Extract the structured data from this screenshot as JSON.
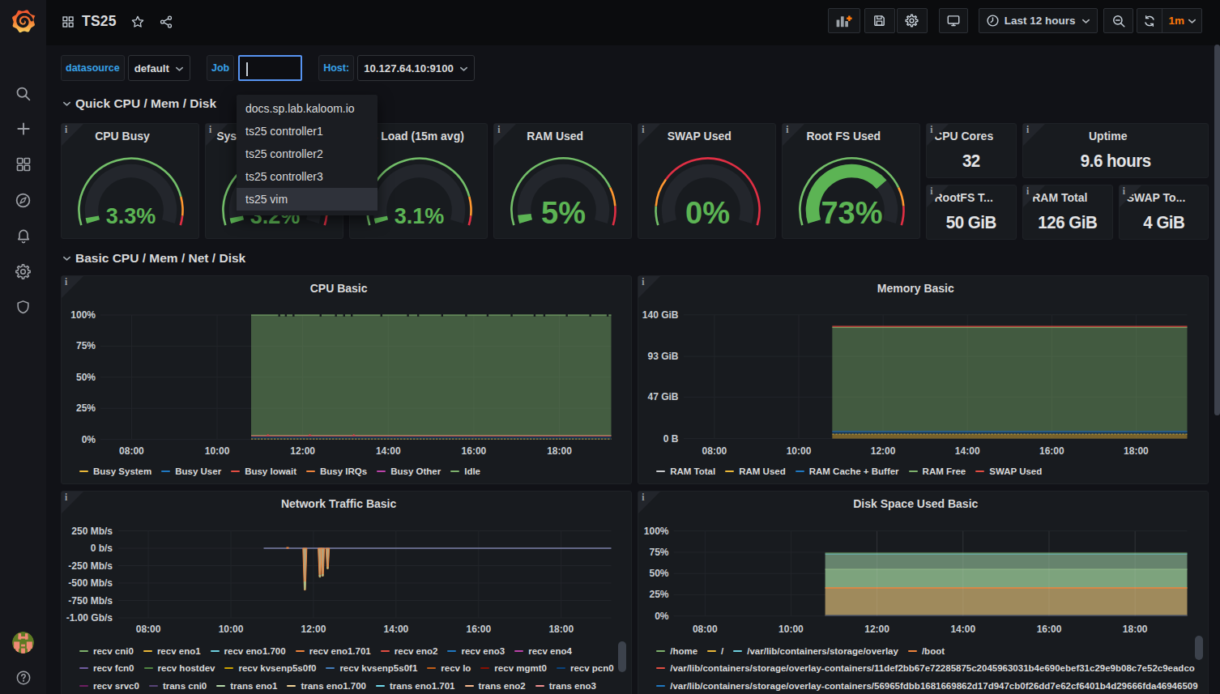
{
  "nav": {
    "title": "TS25",
    "time_range": "Last 12 hours",
    "refresh_interval": "1m",
    "actions": [
      "add-panel",
      "save-dashboard",
      "dashboard-settings",
      "cycle-view-mode",
      "time-picker",
      "zoom-out-time-range",
      "refresh-dashboard",
      "refresh-interval-picker"
    ]
  },
  "sidebar": {
    "items": [
      "search",
      "create",
      "dashboards",
      "explore",
      "alerting",
      "configuration",
      "server-admin"
    ],
    "bottom": [
      "user-avatar",
      "help"
    ]
  },
  "variables": [
    {
      "label": "datasource",
      "value": "default"
    },
    {
      "label": "Job",
      "value": ""
    },
    {
      "label": "Host:",
      "value": "10.127.64.10:9100"
    }
  ],
  "job_dropdown": {
    "options": [
      "docs.sp.lab.kaloom.io",
      "ts25 controller1",
      "ts25 controller2",
      "ts25 controller3",
      "ts25 vim"
    ],
    "highlighted": "ts25 vim"
  },
  "rows": [
    {
      "title": "Quick CPU / Mem / Disk"
    },
    {
      "title": "Basic CPU / Mem / Net / Disk"
    }
  ],
  "colors": {
    "green": "#5cb454",
    "orange": "#ff9830",
    "red": "#e02f44",
    "track": "#23262c",
    "panel": "#181b1f",
    "grid": "#22252a",
    "accent_orange": "#ff780a",
    "focus_blue": "#5794f2"
  },
  "gauges": [
    {
      "title": "CPU Busy",
      "value": "3.3%",
      "fraction": 0.033,
      "col": 0,
      "big": false,
      "thresholds": [
        {
          "to": 0.85,
          "color": "#73bf69"
        },
        {
          "to": 0.95,
          "color": "#ff9830"
        },
        {
          "to": 1,
          "color": "#e02f44"
        }
      ]
    },
    {
      "title": "Sys Load (5m avg)",
      "value": "3.2%",
      "fraction": 0.032,
      "col": 3,
      "big": false,
      "thresholds": [
        {
          "to": 0.85,
          "color": "#73bf69"
        },
        {
          "to": 0.95,
          "color": "#ff9830"
        },
        {
          "to": 1,
          "color": "#e02f44"
        }
      ]
    },
    {
      "title": "Sys Load (15m avg)",
      "value": "3.1%",
      "fraction": 0.031,
      "col": 6,
      "big": false,
      "thresholds": [
        {
          "to": 0.85,
          "color": "#73bf69"
        },
        {
          "to": 0.95,
          "color": "#ff9830"
        },
        {
          "to": 1,
          "color": "#e02f44"
        }
      ]
    },
    {
      "title": "RAM Used",
      "value": "5%",
      "fraction": 0.05,
      "col": 9,
      "big": true,
      "thresholds": [
        {
          "to": 0.8,
          "color": "#73bf69"
        },
        {
          "to": 0.9,
          "color": "#ff9830"
        },
        {
          "to": 1,
          "color": "#e02f44"
        }
      ]
    },
    {
      "title": "SWAP Used",
      "value": "0%",
      "fraction": 0.0,
      "col": 12,
      "big": true,
      "thresholds": [
        {
          "to": 0.1,
          "color": "#73bf69"
        },
        {
          "to": 0.25,
          "color": "#ff9830"
        },
        {
          "to": 1,
          "color": "#e02f44"
        }
      ]
    },
    {
      "title": "Root FS Used",
      "value": "73%",
      "fraction": 0.73,
      "col": 15,
      "big": true,
      "thresholds": [
        {
          "to": 0.8,
          "color": "#73bf69"
        },
        {
          "to": 0.9,
          "color": "#ff9830"
        },
        {
          "to": 1,
          "color": "#e02f44"
        }
      ]
    }
  ],
  "stats": [
    {
      "title": "CPU Cores",
      "value": "32",
      "col": 18,
      "row": 0,
      "w": 2
    },
    {
      "title": "Uptime",
      "value": "9.6 hours",
      "col": 20,
      "row": 0,
      "w": 4
    },
    {
      "title": "RootFS T...",
      "value": "50 GiB",
      "col": 18,
      "row": 1,
      "w": 2
    },
    {
      "title": "RAM Total",
      "value": "126 GiB",
      "col": 20,
      "row": 1,
      "w": 2
    },
    {
      "title": "SWAP To...",
      "value": "4 GiB",
      "col": 22,
      "row": 1,
      "w": 2
    }
  ],
  "chart_data": [
    {
      "id": "cpu-basic",
      "type": "area",
      "title": "CPU Basic",
      "ylabel": "",
      "xlabel": "",
      "grid": true,
      "legend_position": "bottom",
      "y_range": [
        0,
        100
      ],
      "y_ticks": [
        {
          "label": "100%",
          "v": 100
        },
        {
          "label": "75%",
          "v": 75
        },
        {
          "label": "50%",
          "v": 50
        },
        {
          "label": "25%",
          "v": 25
        },
        {
          "label": "0%",
          "v": 0
        }
      ],
      "x_ticks": [
        {
          "label": "08:00",
          "f": 0.061
        },
        {
          "label": "10:00",
          "f": 0.2285
        },
        {
          "label": "12:00",
          "f": 0.396
        },
        {
          "label": "14:00",
          "f": 0.5635
        },
        {
          "label": "16:00",
          "f": 0.731
        },
        {
          "label": "18:00",
          "f": 0.8985
        }
      ],
      "data_start_f": 0.295,
      "layers": [
        {
          "t": "area",
          "y0": 3.2,
          "y1": 100,
          "color": "#7eb26d",
          "opacity": 0.44
        },
        {
          "t": "hline",
          "y": 100,
          "color": "#7eb26d",
          "w": 1.2
        },
        {
          "t": "notches",
          "y": 100,
          "depth": 3,
          "f": [
            0.35,
            0.363,
            0.378,
            0.431,
            0.461,
            0.477,
            0.492,
            0.55,
            0.602,
            0.622,
            0.669,
            0.716,
            0.758,
            0.805,
            0.85,
            0.869,
            0.913,
            0.959,
            0.993
          ]
        },
        {
          "t": "hline",
          "y": 3.2,
          "color": "#7eb26d",
          "w": 1
        },
        {
          "t": "area",
          "y0": 0,
          "y1": 2.8,
          "color": "#1f78c1",
          "opacity": 0.3
        },
        {
          "t": "hline",
          "y": 2.8,
          "color": "#bf4a4d",
          "w": 1.3
        },
        {
          "t": "bump",
          "y": 2.8,
          "f": [
            0.328,
            0.41,
            0.496
          ],
          "color": "#bf4a4d"
        },
        {
          "t": "hline",
          "y": 0.35,
          "color": "#ab8e33",
          "w": 1.2,
          "dash": "2.5,1.5"
        }
      ],
      "legend_rows": [
        [
          {
            "label": "Busy System",
            "color": "#eab839"
          },
          {
            "label": "Busy User",
            "color": "#1f78c1"
          },
          {
            "label": "Busy Iowait",
            "color": "#e24d42"
          },
          {
            "label": "Busy IRQs",
            "color": "#ef843c"
          },
          {
            "label": "Busy Other",
            "color": "#ba43a9"
          },
          {
            "label": "Idle",
            "color": "#7eb26d"
          }
        ]
      ]
    },
    {
      "id": "memory-basic",
      "type": "area",
      "title": "Memory Basic",
      "ylabel": "",
      "xlabel": "",
      "grid": true,
      "legend_position": "bottom",
      "y_range": [
        0,
        140
      ],
      "y_ticks": [
        {
          "label": "140 GiB",
          "v": 140
        },
        {
          "label": "93 GiB",
          "v": 93
        },
        {
          "label": "47 GiB",
          "v": 47
        },
        {
          "label": "0 B",
          "v": 0
        }
      ],
      "x_ticks": [
        {
          "label": "08:00",
          "f": 0.061
        },
        {
          "label": "10:00",
          "f": 0.2285
        },
        {
          "label": "12:00",
          "f": 0.396
        },
        {
          "label": "14:00",
          "f": 0.5635
        },
        {
          "label": "16:00",
          "f": 0.731
        },
        {
          "label": "18:00",
          "f": 0.8985
        }
      ],
      "data_start_f": 0.295,
      "layers": [
        {
          "t": "area",
          "y0": 8,
          "y1": 125.8,
          "color": "#7eb26d",
          "opacity": 0.42
        },
        {
          "t": "hline",
          "y": 125.8,
          "color": "#7eb26d",
          "w": 1
        },
        {
          "t": "hline",
          "y": 126.9,
          "color": "#e24d42",
          "w": 1.3
        },
        {
          "t": "area",
          "y0": 5,
          "y1": 8,
          "color": "#1f78c1",
          "opacity": 0.3
        },
        {
          "t": "hline",
          "y": 8,
          "color": "#2a6aa5",
          "w": 1.3
        },
        {
          "t": "area",
          "y0": 0,
          "y1": 5,
          "color": "#eab839",
          "opacity": 0.45
        },
        {
          "t": "hline",
          "y": 5,
          "color": "#b2933a",
          "w": 1.2,
          "dash": "2.5,1.5"
        }
      ],
      "legend_rows": [
        [
          {
            "label": "RAM Total",
            "color": "#c9cbce"
          },
          {
            "label": "RAM Used",
            "color": "#eab839"
          },
          {
            "label": "RAM Cache + Buffer",
            "color": "#1f78c1"
          },
          {
            "label": "RAM Free",
            "color": "#7eb26d"
          },
          {
            "label": "SWAP Used",
            "color": "#e24d42"
          }
        ]
      ]
    },
    {
      "id": "network-traffic-basic",
      "type": "line",
      "title": "Network Traffic Basic",
      "ylabel": "",
      "xlabel": "",
      "grid": true,
      "legend_position": "bottom",
      "y_range": [
        -1000,
        250
      ],
      "y_ticks": [
        {
          "label": "250 Mb/s",
          "v": 250
        },
        {
          "label": "0 b/s",
          "v": 0
        },
        {
          "label": "-250 Mb/s",
          "v": -250
        },
        {
          "label": "-500 Mb/s",
          "v": -500
        },
        {
          "label": "-750 Mb/s",
          "v": -750
        },
        {
          "label": "-1.00 Gb/s",
          "v": -1000
        }
      ],
      "x_ticks": [
        {
          "label": "08:00",
          "f": 0.061
        },
        {
          "label": "10:00",
          "f": 0.2285
        },
        {
          "label": "12:00",
          "f": 0.396
        },
        {
          "label": "14:00",
          "f": 0.5635
        },
        {
          "label": "16:00",
          "f": 0.731
        },
        {
          "label": "18:00",
          "f": 0.8985
        }
      ],
      "data_start_f": 0.295,
      "layers": [
        {
          "t": "hline",
          "y": 0,
          "color": "#7b80a8",
          "w": 1.4
        },
        {
          "t": "dot",
          "f": 0.3435,
          "y": 0,
          "color": "#ef843c"
        },
        {
          "t": "spike",
          "f": 0.3785,
          "v": -600,
          "wtop": 5,
          "color": "#ef843c",
          "fill": "#b5a27a",
          "tip": "#9ec08c",
          "tipv": -480
        },
        {
          "t": "spike",
          "f": 0.409,
          "v": -415,
          "wtop": 4.5,
          "color": "#ef843c",
          "fill": "#b5a27a",
          "tip": "#9ec08c",
          "tipv": -385
        },
        {
          "t": "spike",
          "f": 0.4147,
          "v": -400,
          "wtop": 4.5,
          "color": "#ef843c",
          "fill": "#b5a27a",
          "tip": "#9ec08c",
          "tipv": -375
        },
        {
          "t": "spike",
          "f": 0.4247,
          "v": -295,
          "wtop": 4.5,
          "color": "#ef843c",
          "fill": "#b5a27a",
          "tip": "#9ec08c",
          "tipv": -272
        }
      ],
      "legend_rows": [
        [
          {
            "label": "recv cni0",
            "color": "#7eb26d"
          },
          {
            "label": "recv eno1",
            "color": "#eab839"
          },
          {
            "label": "recv eno1.700",
            "color": "#6ed0e0"
          },
          {
            "label": "recv eno1.701",
            "color": "#ef843c"
          },
          {
            "label": "recv eno2",
            "color": "#e24d42"
          },
          {
            "label": "recv eno3",
            "color": "#1f78c1"
          },
          {
            "label": "recv eno4",
            "color": "#ba43a9"
          }
        ],
        [
          {
            "label": "recv fcn0",
            "color": "#705da0"
          },
          {
            "label": "recv hostdev",
            "color": "#508642"
          },
          {
            "label": "recv kvsenp5s0f0",
            "color": "#cca300"
          },
          {
            "label": "recv kvsenp5s0f1",
            "color": "#447ebc"
          },
          {
            "label": "recv lo",
            "color": "#c15c17"
          },
          {
            "label": "recv mgmt0",
            "color": "#890f02"
          },
          {
            "label": "recv pcn0",
            "color": "#0a437c"
          }
        ],
        [
          {
            "label": "recv srvc0",
            "color": "#6d1f62"
          },
          {
            "label": "trans cni0",
            "color": "#584477"
          },
          {
            "label": "trans eno1",
            "color": "#b7dbab"
          },
          {
            "label": "trans eno1.700",
            "color": "#f4d598"
          },
          {
            "label": "trans eno1.701",
            "color": "#70dbed"
          },
          {
            "label": "trans eno2",
            "color": "#f9ba8f"
          },
          {
            "label": "trans eno3",
            "color": "#f29191"
          }
        ]
      ],
      "legend_scrollbar": {
        "top": 185,
        "height": 38
      }
    },
    {
      "id": "disk-space-used-basic",
      "type": "area",
      "title": "Disk Space Used Basic",
      "regrid": true,
      "ylabel": "",
      "xlabel": "",
      "grid": true,
      "legend_position": "bottom",
      "y_range": [
        0,
        100
      ],
      "y_ticks": [
        {
          "label": "100%",
          "v": 100
        },
        {
          "label": "75%",
          "v": 75
        },
        {
          "label": "50%",
          "v": 50
        },
        {
          "label": "25%",
          "v": 25
        },
        {
          "label": "0%",
          "v": 0
        }
      ],
      "x_ticks": [
        {
          "label": "08:00",
          "f": 0.061
        },
        {
          "label": "10:00",
          "f": 0.2285
        },
        {
          "label": "12:00",
          "f": 0.396
        },
        {
          "label": "14:00",
          "f": 0.5635
        },
        {
          "label": "16:00",
          "f": 0.731
        },
        {
          "label": "18:00",
          "f": 0.8985
        }
      ],
      "data_start_f": 0.295,
      "layers": [
        {
          "t": "area",
          "y0": 0,
          "y1": 33,
          "color": "#9f8a5c",
          "opacity": 1
        },
        {
          "t": "area",
          "y0": 33,
          "y1": 55,
          "color": "#7da37d",
          "opacity": 1
        },
        {
          "t": "area",
          "y0": 55,
          "y1": 73,
          "color": "#66836d",
          "opacity": 1
        },
        {
          "t": "hline",
          "y": 33,
          "color": "#ef843c",
          "w": 1.4
        },
        {
          "t": "hline",
          "y": 55,
          "color": "#94bb8c",
          "w": 1
        },
        {
          "t": "hline",
          "y": 73,
          "color": "#6ed0e0",
          "w": 1.1
        },
        {
          "t": "hline",
          "y": 74,
          "color": "#7eb26d",
          "w": 1
        },
        {
          "t": "hline",
          "y": 0.6,
          "color": "#2b3a5e",
          "w": 1.3
        }
      ],
      "legend_rows": [
        [
          {
            "label": "/home",
            "color": "#7eb26d"
          },
          {
            "label": "/",
            "color": "#eab839"
          },
          {
            "label": "/var/lib/containers/storage/overlay",
            "color": "#6ed0e0"
          },
          {
            "label": "/boot",
            "color": "#ef843c"
          }
        ],
        [
          {
            "label": "/var/lib/containers/storage/overlay-containers/11def2bb67e72285875c2045963031b4e690ebef31c29e9b08c7e52c9eadco",
            "color": "#e24d42"
          }
        ],
        [
          {
            "label": "/var/lib/containers/storage/overlay-containers/56965fdbb1681669862d17d947cb0f26dd7e62cf6401b4d29666fda46946509",
            "color": "#1f78c1"
          }
        ]
      ],
      "legend_scrollbar": {
        "top": 178,
        "height": 30
      }
    }
  ]
}
